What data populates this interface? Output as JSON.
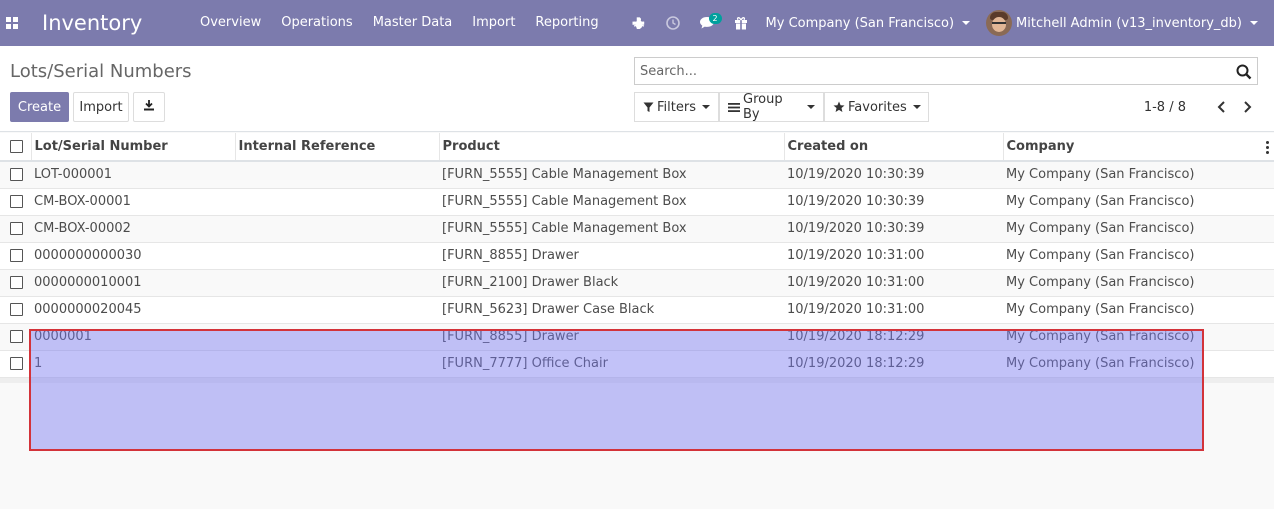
{
  "navbar": {
    "app_name": "Inventory",
    "menu": [
      "Overview",
      "Operations",
      "Master Data",
      "Import",
      "Reporting"
    ],
    "messages_badge": "2",
    "company": "My Company (San Francisco)",
    "user": "Mitchell Admin (v13_inventory_db)",
    "color": "#7c7bad"
  },
  "control_panel": {
    "breadcrumb": "Lots/Serial Numbers",
    "search_placeholder": "Search...",
    "create_label": "Create",
    "import_label": "Import",
    "filters_label": "Filters",
    "groupby_label": "Group By",
    "favorites_label": "Favorites",
    "pager": "1-8 / 8"
  },
  "table": {
    "columns": [
      "Lot/Serial Number",
      "Internal Reference",
      "Product",
      "Created on",
      "Company"
    ],
    "rows": [
      [
        "LOT-000001",
        "",
        "[FURN_5555] Cable Management Box",
        "10/19/2020 10:30:39",
        "My Company (San Francisco)"
      ],
      [
        "CM-BOX-00001",
        "",
        "[FURN_5555] Cable Management Box",
        "10/19/2020 10:30:39",
        "My Company (San Francisco)"
      ],
      [
        "CM-BOX-00002",
        "",
        "[FURN_5555] Cable Management Box",
        "10/19/2020 10:30:39",
        "My Company (San Francisco)"
      ],
      [
        "0000000000030",
        "",
        "[FURN_8855] Drawer",
        "10/19/2020 10:31:00",
        "My Company (San Francisco)"
      ],
      [
        "0000000010001",
        "",
        "[FURN_2100] Drawer Black",
        "10/19/2020 10:31:00",
        "My Company (San Francisco)"
      ],
      [
        "0000000020045",
        "",
        "[FURN_5623] Drawer Case Black",
        "10/19/2020 10:31:00",
        "My Company (San Francisco)"
      ],
      [
        "0000001",
        "",
        "[FURN_8855] Drawer",
        "10/19/2020 18:12:29",
        "My Company (San Francisco)"
      ],
      [
        "1",
        "",
        "[FURN_7777] Office Chair",
        "10/19/2020 18:12:29",
        "My Company (San Francisco)"
      ]
    ]
  },
  "selection_overlay": {
    "fill": "#7878f0",
    "border": "#d3333a"
  }
}
